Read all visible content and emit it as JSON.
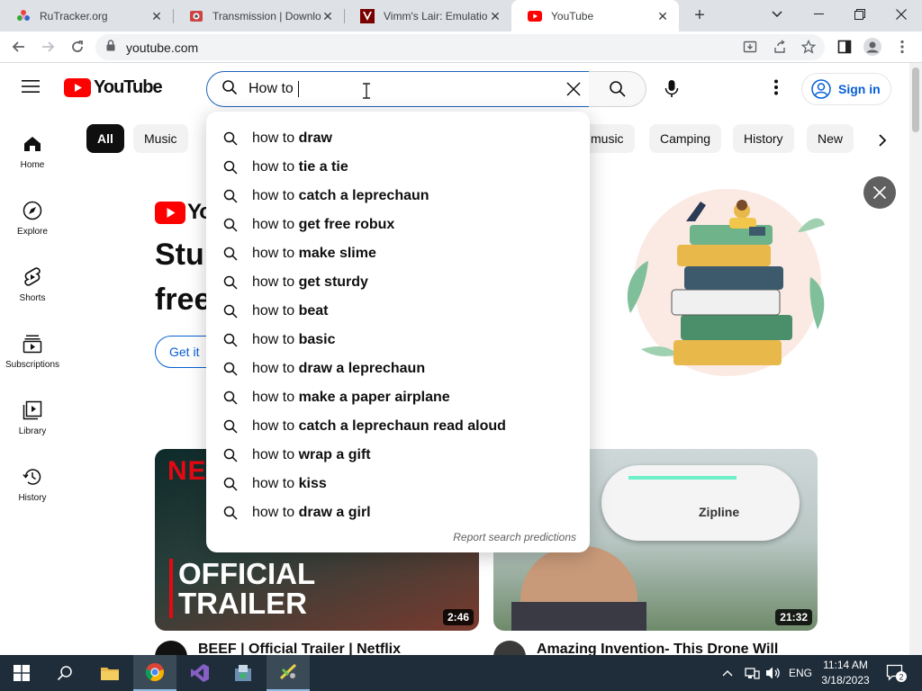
{
  "browser": {
    "tabs": [
      {
        "title": "RuTracker.org",
        "favicon": "rutracker-icon",
        "active": false
      },
      {
        "title": "Transmission | Downloa",
        "favicon": "transmission-icon",
        "active": false
      },
      {
        "title": "Vimm's Lair: Emulation",
        "favicon": "vimm-icon",
        "active": false
      },
      {
        "title": "YouTube",
        "favicon": "youtube-icon",
        "active": true
      }
    ],
    "url": "youtube.com"
  },
  "youtube": {
    "logo_text": "YouTube",
    "search": {
      "query": "How to ",
      "placeholder": "Search"
    },
    "signin_label": "Sign in",
    "accent": "#ff0000",
    "link_color": "#065fd4"
  },
  "sidebar": {
    "items": [
      {
        "label": "Home",
        "icon": "home-icon"
      },
      {
        "label": "Explore",
        "icon": "compass-icon"
      },
      {
        "label": "Shorts",
        "icon": "shorts-icon"
      },
      {
        "label": "Subscriptions",
        "icon": "subscriptions-icon"
      },
      {
        "label": "Library",
        "icon": "library-icon"
      },
      {
        "label": "History",
        "icon": "history-icon"
      }
    ]
  },
  "chips": [
    "All",
    "Music",
    "music",
    "Camping",
    "History",
    "New"
  ],
  "suggestions": {
    "prefix": "how to ",
    "items": [
      "draw",
      "tie a tie",
      "catch a leprechaun",
      "get free robux",
      "make slime",
      "get sturdy",
      "beat",
      "basic",
      "draw a leprechaun",
      "make a paper airplane",
      "catch a leprechaun read aloud",
      "wrap a gift",
      "kiss",
      "draw a girl"
    ],
    "report_label": "Report search predictions"
  },
  "banner": {
    "logo_partial": "Yo",
    "headline_line1": "Stu",
    "headline_line2": "free",
    "cta_partial": "Get it"
  },
  "videos": [
    {
      "thumb_text_1": "OFFICIAL",
      "thumb_text_2": "TRAILER",
      "brand_partial": "NETF",
      "duration": "2:46",
      "title": "BEEF | Official Trailer | Netflix"
    },
    {
      "thumb_brand": "Zipline",
      "duration": "21:32",
      "title": "Amazing Invention- This Drone Will"
    }
  ],
  "taskbar": {
    "language": "ENG",
    "time": "11:14 AM",
    "date": "3/18/2023",
    "notification_count": "2"
  }
}
